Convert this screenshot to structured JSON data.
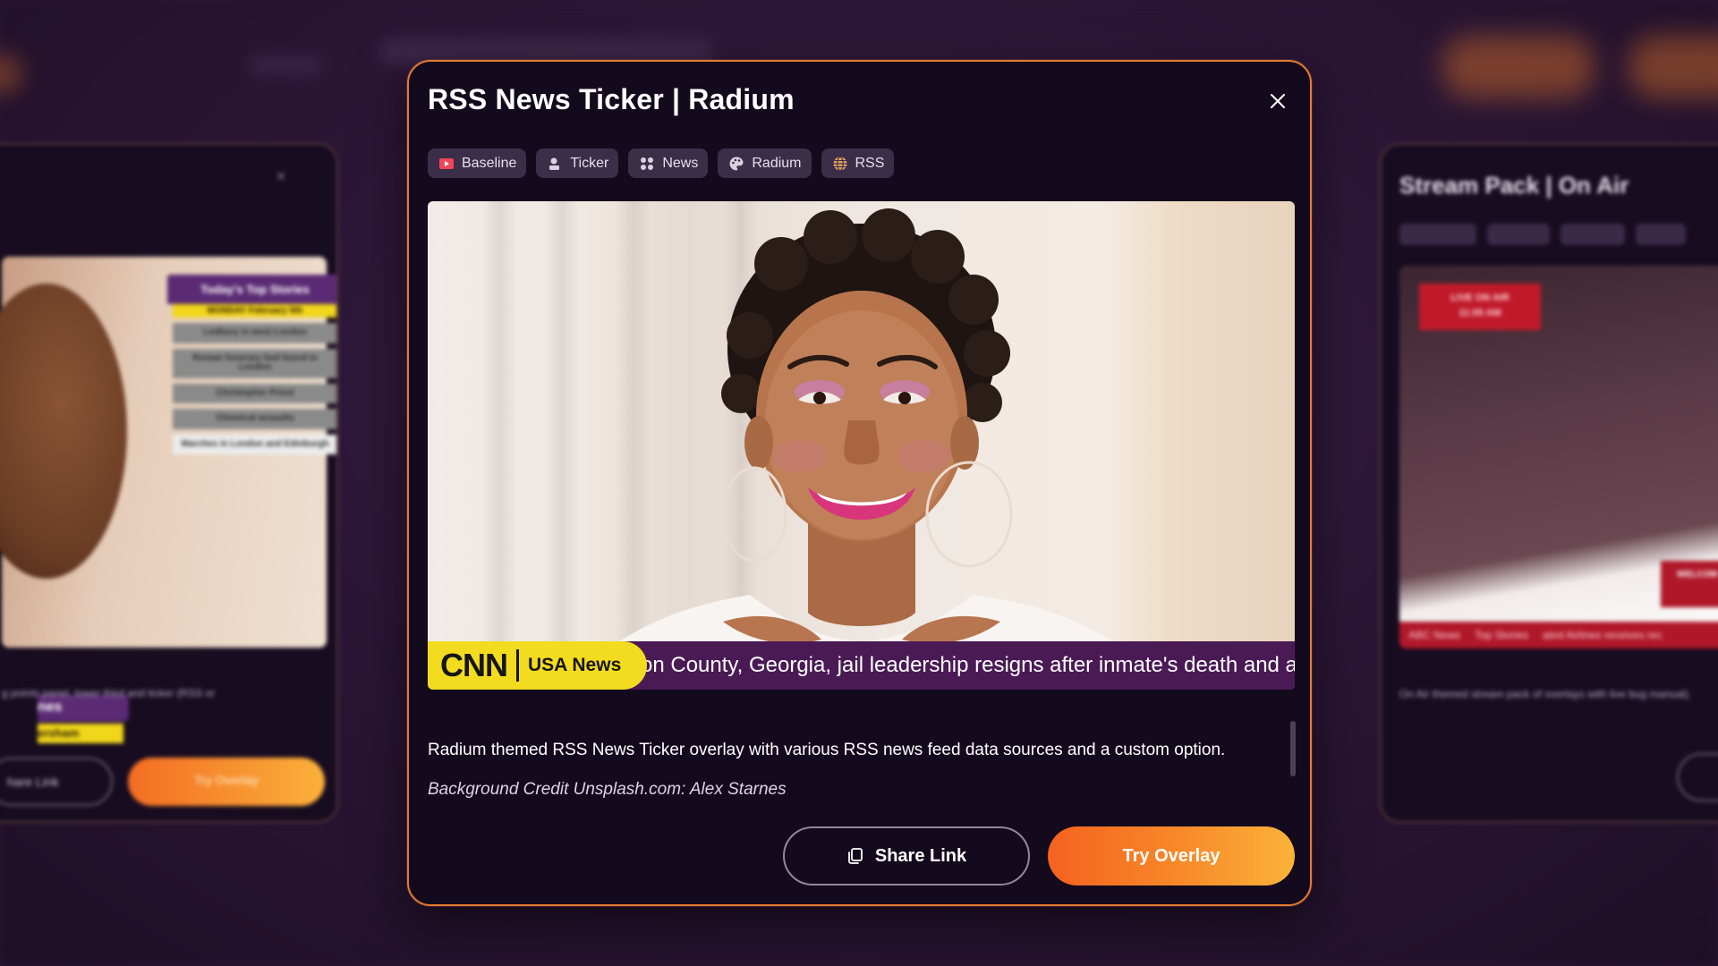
{
  "modal": {
    "title": "RSS News Ticker | Radium",
    "close_icon": "close-icon",
    "tags": [
      {
        "label": "Baseline",
        "icon": "play-icon",
        "color": "#f0455a"
      },
      {
        "label": "Ticker",
        "icon": "person-icon",
        "color": "#d8d2e0"
      },
      {
        "label": "News",
        "icon": "grid-icon",
        "color": "#d8d2e0"
      },
      {
        "label": "Radium",
        "icon": "palette-icon",
        "color": "#d8d2e0"
      },
      {
        "label": "RSS",
        "icon": "globe-icon",
        "color": "#e0a060"
      }
    ],
    "preview": {
      "ticker_brand": "CNN",
      "ticker_label": "USA News",
      "ticker_text": "on County, Georgia, jail leadership resigns after inmate's death and a"
    },
    "description": "Radium themed RSS News Ticker overlay with various RSS news feed data sources and a custom option.",
    "credit": "Background Credit Unsplash.com: Alex Starnes",
    "share_label": "Share Link",
    "try_label": "Try Overlay"
  },
  "left_card": {
    "stories_title": "Today's Top Stories",
    "stories_date": "MONDAY February 5th",
    "stories": [
      "Ledbury in west London",
      "Roman funerary bed found in London",
      "Christopher Priest",
      "Chemical assaults",
      "Marches in London and Edinburgh"
    ],
    "lower_third_1": "nes",
    "lower_third_2": "ersham",
    "description": "g points panel, lower third and ticker (RSS or",
    "share_label": "hare Link",
    "try_label": "Try Overlay"
  },
  "right_card": {
    "title": "Stream Pack | On Air",
    "badge_line1": "LIVE ON AIR",
    "badge_line2": "11:05 AM",
    "welcome": "WELCOM",
    "ticker_items": [
      "ABC News",
      "Top Stories",
      "ated Airlines receives rec"
    ],
    "description": "On Air themed stream pack of overlays with live bug manual)."
  },
  "colors": {
    "accent": "#f36c23",
    "accent_end": "#fbb33a",
    "ticker_purple": "#4a1a55",
    "brand_yellow": "#f3dc1f"
  }
}
